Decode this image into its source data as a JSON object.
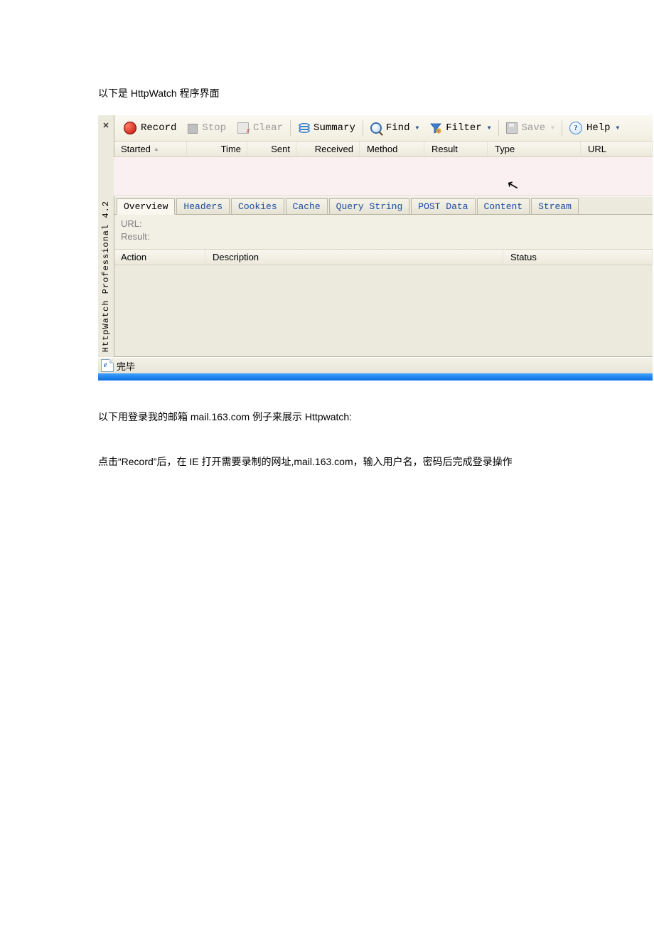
{
  "doc": {
    "p1": "以下是 HttpWatch 程序界面",
    "p2": "以下用登录我的邮箱 mail.163.com 例子来展示 Httpwatch:",
    "p3": "点击“Record”后，在 IE 打开需要录制的网址,mail.163.com，输入用户名，密码后完成登录操作"
  },
  "app": {
    "sideLabel": "HttpWatch Professional 4.2",
    "close": "✕",
    "toolbar": {
      "record": "Record",
      "stop": "Stop",
      "clear": "Clear",
      "summary": "Summary",
      "find": "Find",
      "filter": "Filter",
      "save": "Save",
      "help": "Help"
    },
    "grid": {
      "cols": {
        "started": "Started",
        "time": "Time",
        "sent": "Sent",
        "received": "Received",
        "method": "Method",
        "result": "Result",
        "type": "Type",
        "url": "URL"
      }
    },
    "detailTabs": {
      "overview": "Overview",
      "headers": "Headers",
      "cookies": "Cookies",
      "cache": "Cache",
      "querystring": "Query String",
      "postdata": "POST Data",
      "content": "Content",
      "stream": "Stream"
    },
    "detail": {
      "urlLabel": "URL:",
      "resultLabel": "Result:"
    },
    "lower": {
      "action": "Action",
      "description": "Description",
      "status": "Status"
    },
    "status": "完毕",
    "helpGlyph": "?"
  }
}
